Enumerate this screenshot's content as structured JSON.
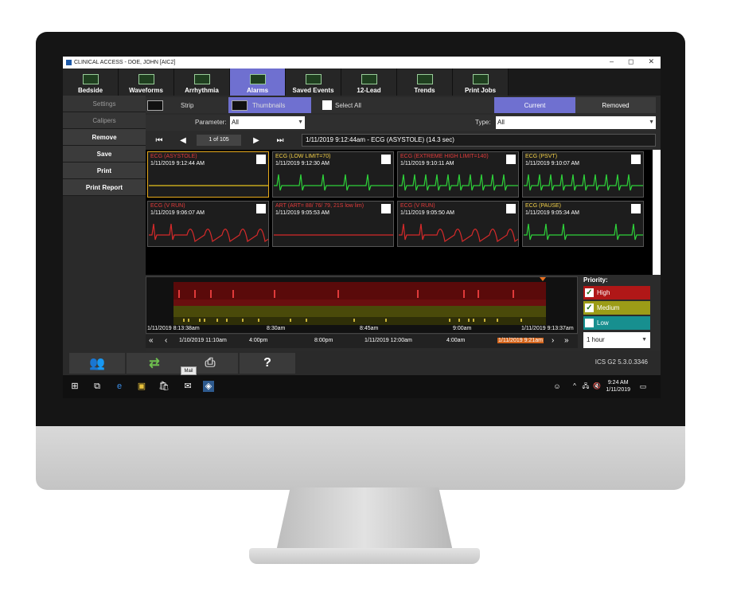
{
  "window": {
    "title": "CLINICAL ACCESS - DOE, JOHN [AIC2]",
    "controls": [
      "–",
      "◻",
      "✕"
    ]
  },
  "nav": [
    {
      "label": "Bedside",
      "icon": "bedside-icon",
      "active": false
    },
    {
      "label": "Waveforms",
      "icon": "waveforms-icon",
      "active": false
    },
    {
      "label": "Arrhythmia",
      "icon": "arrhythmia-icon",
      "active": false
    },
    {
      "label": "Alarms",
      "icon": "alarms-icon",
      "active": true
    },
    {
      "label": "Saved Events",
      "icon": "saved-events-icon",
      "active": false
    },
    {
      "label": "12-Lead",
      "icon": "twelve-lead-icon",
      "active": false
    },
    {
      "label": "Trends",
      "icon": "trends-icon",
      "active": false
    },
    {
      "label": "Print Jobs",
      "icon": "print-jobs-icon",
      "active": false
    }
  ],
  "left_panel": {
    "settings": "Settings",
    "calipers": "Calipers",
    "remove": "Remove",
    "save": "Save",
    "print": "Print",
    "print_report": "Print Report"
  },
  "toolbar": {
    "strip": "Strip",
    "thumbnails": "Thumbnails",
    "select_all": "Select All",
    "current": "Current",
    "removed": "Removed"
  },
  "filters": {
    "parameter_label": "Parameter:",
    "parameter_value": "All",
    "type_label": "Type:",
    "type_value": "All"
  },
  "pager": {
    "count": "1 of 105",
    "event_title": "1/11/2019 9:12:44am - ECG (ASYSTOLE) (14.3 sec)"
  },
  "thumbnails": [
    {
      "title": "ECG (ASYSTOLE)",
      "time": "1/11/2019 9:12:44 AM",
      "color": "#e23b3b",
      "wave": "flat-yellow",
      "selected": true
    },
    {
      "title": "ECG (LOW LIMIT=70)",
      "time": "1/11/2019 9:12:30 AM",
      "color": "#f5d24a",
      "wave": "low",
      "selected": false
    },
    {
      "title": "ECG (EXTREME HIGH LIMIT=140)",
      "time": "1/11/2019 9:10:11 AM",
      "color": "#e23b3b",
      "wave": "fast",
      "selected": false
    },
    {
      "title": "ECG (PSVT)",
      "time": "1/11/2019 9:10:07 AM",
      "color": "#f5d24a",
      "wave": "fast",
      "selected": false
    },
    {
      "title": "ECG (V RUN)",
      "time": "1/11/2019 9:06:07 AM",
      "color": "#e23b3b",
      "wave": "vrun",
      "selected": false
    },
    {
      "title": "ART (ART= 88/ 76/ 79, 21S low lim)",
      "time": "1/11/2019 9:05:53 AM",
      "color": "#e23b3b",
      "wave": "flat-red",
      "selected": false
    },
    {
      "title": "ECG (V RUN)",
      "time": "1/11/2019 9:05:50 AM",
      "color": "#e23b3b",
      "wave": "vrun",
      "selected": false
    },
    {
      "title": "ECG (PAUSE)",
      "time": "1/11/2019 9:05:34 AM",
      "color": "#f5d24a",
      "wave": "pause",
      "selected": false
    }
  ],
  "timeline": {
    "start": "1/11/2019 8:13:38am",
    "t1": "8:30am",
    "t2": "8:45am",
    "t3": "9:00am",
    "end": "1/11/2019 9:13:37am",
    "nav_labels": [
      "1/10/2019 11:10am",
      "4:00pm",
      "8:00pm",
      "1/11/2019 12:00am",
      "4:00am",
      "1/11/2019 9:21am"
    ]
  },
  "priority": {
    "title": "Priority:",
    "items": [
      {
        "label": "High",
        "checked": true,
        "color": "#b01717"
      },
      {
        "label": "Medium",
        "checked": true,
        "color": "#9c9c17"
      },
      {
        "label": "Low",
        "checked": false,
        "color": "#178f8f"
      }
    ],
    "range": "1 hour"
  },
  "bottom": {
    "help": "?",
    "version": "ICS G2 5.3.0.3346",
    "tooltip": "Mail"
  },
  "taskbar": {
    "time": "9:24 AM",
    "date": "1/11/2019"
  }
}
